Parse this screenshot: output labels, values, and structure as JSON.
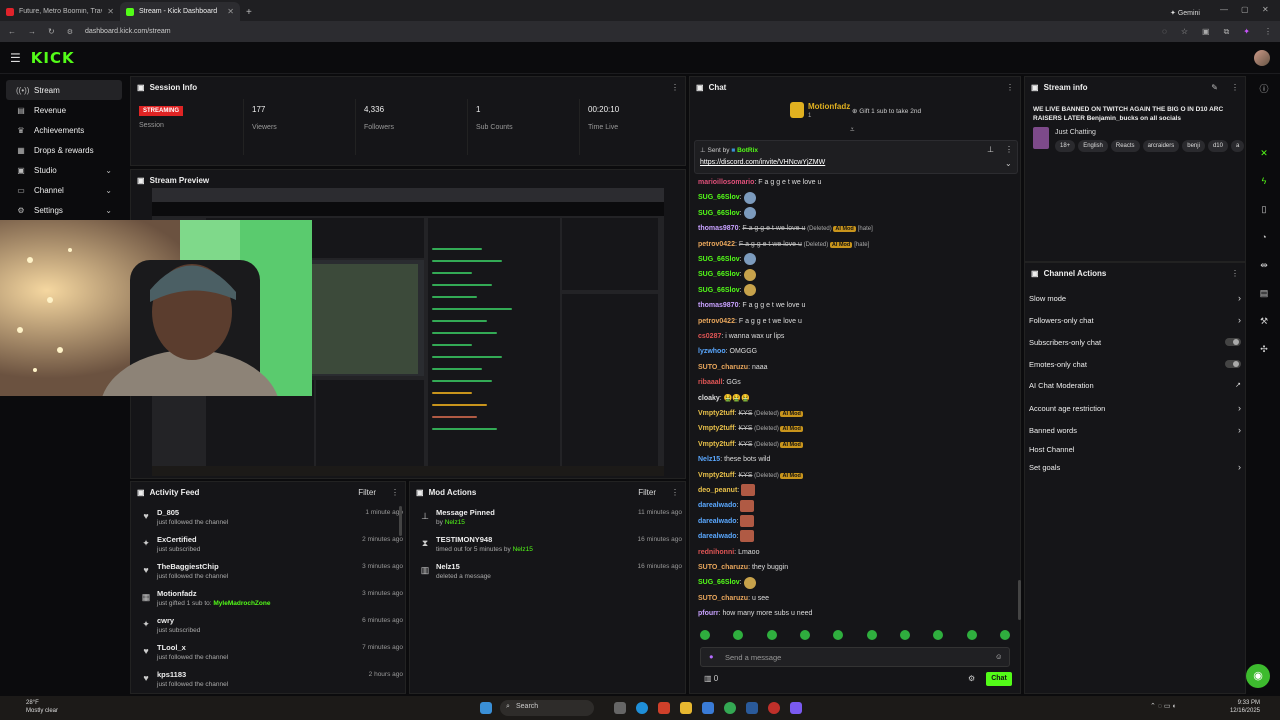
{
  "browser": {
    "tabs": [
      {
        "title": "Future, Metro Boomin, Travis S",
        "active": false,
        "color": "#e0232b"
      },
      {
        "title": "Stream - Kick Dashboard",
        "active": true,
        "color": "#53fc18"
      }
    ],
    "gemini": "Gemini",
    "url": "dashboard.kick.com/stream"
  },
  "app": {
    "logo": "KICK",
    "accent": "#53fc18"
  },
  "sidebar": {
    "items": [
      {
        "label": "Stream",
        "icon": "stream-icon",
        "active": true,
        "chevron": false
      },
      {
        "label": "Revenue",
        "icon": "revenue-icon",
        "active": false,
        "chevron": false
      },
      {
        "label": "Achievements",
        "icon": "trophy-icon",
        "active": false,
        "chevron": false
      },
      {
        "label": "Drops & rewards",
        "icon": "gift-icon",
        "active": false,
        "chevron": false
      },
      {
        "label": "Studio",
        "icon": "studio-icon",
        "active": false,
        "chevron": true
      },
      {
        "label": "Channel",
        "icon": "channel-icon",
        "active": false,
        "chevron": true
      },
      {
        "label": "Settings",
        "icon": "gear-icon",
        "active": false,
        "chevron": true
      }
    ]
  },
  "session": {
    "title": "Session Info",
    "status": "STREAMING",
    "stats": [
      {
        "value": "",
        "label": "Session"
      },
      {
        "value": "177",
        "label": "Viewers"
      },
      {
        "value": "4,336",
        "label": "Followers"
      },
      {
        "value": "1",
        "label": "Sub Counts"
      },
      {
        "value": "00:20:10",
        "label": "Time Live"
      }
    ]
  },
  "preview": {
    "title": "Stream Preview"
  },
  "activity": {
    "title": "Activity Feed",
    "filter": "Filter",
    "items": [
      {
        "name": "D_805",
        "desc": "just followed the channel",
        "time": "1 minute ago",
        "icon": "heart-icon"
      },
      {
        "name": "ExCertified",
        "desc": "just subscribed",
        "time": "2 minutes ago",
        "icon": "star-icon"
      },
      {
        "name": "TheBaggiestChip",
        "desc": "just followed the channel",
        "time": "3 minutes ago",
        "icon": "heart-icon"
      },
      {
        "name": "Motionfadz",
        "desc": "just gifted 1 sub to:",
        "target": "MyleMadrochZone",
        "time": "3 minutes ago",
        "icon": "gift-icon"
      },
      {
        "name": "cwry",
        "desc": "just subscribed",
        "time": "6 minutes ago",
        "icon": "star-icon"
      },
      {
        "name": "TLool_x",
        "desc": "just followed the channel",
        "time": "7 minutes ago",
        "icon": "heart-icon"
      },
      {
        "name": "kps1183",
        "desc": "just followed the channel",
        "time": "2 hours ago",
        "icon": "heart-icon"
      }
    ]
  },
  "mod": {
    "title": "Mod Actions",
    "filter": "Filter",
    "items": [
      {
        "name": "Message Pinned",
        "prefix": "by",
        "actor": "Nelz15",
        "time": "11 minutes ago",
        "icon": "pin-icon"
      },
      {
        "name": "TESTIMONY948",
        "prefix": "timed out for 5 minutes by",
        "actor": "Nelz15",
        "time": "16 minutes ago",
        "icon": "hourglass-icon"
      },
      {
        "name": "Nelz15",
        "prefix": "deleted a message",
        "actor": "",
        "time": "16 minutes ago",
        "icon": "trash-icon"
      }
    ]
  },
  "chat": {
    "title": "Chat",
    "gifter": "Motionfadz",
    "gifter_count": "1",
    "gift_text": "Gift 1 sub to take 2nd",
    "pinned_by_label": "Sent by",
    "pinned_by": "BotRix",
    "pinned_link": "https://discord.com/invite/VHNcwYjZMW",
    "input_placeholder": "Send a message",
    "count": "0",
    "send_label": "Chat",
    "messages": [
      {
        "user": "marioillosomario",
        "color": "#e0507a",
        "text": "F a g g e t we love u"
      },
      {
        "user": "SUG_66Slov",
        "color": "#53fc18",
        "text": "",
        "emote": "b"
      },
      {
        "user": "SUG_66Slov",
        "color": "#53fc18",
        "text": "",
        "emote": "b"
      },
      {
        "user": "thomas9870",
        "color": "#c8a2ff",
        "text": "F a g g e t we love u",
        "deleted": true,
        "aimod": "AI Mod",
        "reason": "[hate]"
      },
      {
        "user": "petrov0422",
        "color": "#e8a65c",
        "text": "F a g g e t we love u",
        "deleted": true,
        "aimod": "AI Mod",
        "reason": "[hate]"
      },
      {
        "user": "SUG_66Slov",
        "color": "#53fc18",
        "text": "",
        "emote": "b"
      },
      {
        "user": "SUG_66Slov",
        "color": "#53fc18",
        "text": "",
        "emote": "y"
      },
      {
        "user": "SUG_66Slov",
        "color": "#53fc18",
        "text": "",
        "emote": "y"
      },
      {
        "user": "thomas9870",
        "color": "#c8a2ff",
        "text": "F a g g e t we love u"
      },
      {
        "user": "petrov0422",
        "color": "#e8a65c",
        "text": "F a g g e t we love u"
      },
      {
        "user": "cs0287",
        "color": "#e05555",
        "text": "i wanna wax ur lips"
      },
      {
        "user": "lyzwhoo",
        "color": "#5aa8ff",
        "text": "OMGGG"
      },
      {
        "user": "SUTO_charuzu",
        "color": "#e8a65c",
        "text": "naaa"
      },
      {
        "user": "ribaaall",
        "color": "#e05555",
        "text": "GGs"
      },
      {
        "user": "cloaky",
        "color": "#dddddd",
        "text": "🤮🤮🤮"
      },
      {
        "user": "Vmpty2tuff",
        "color": "#e8c04a",
        "text": "KYS",
        "deleted": true,
        "aimod": "AI Mod"
      },
      {
        "user": "Vmpty2tuff",
        "color": "#e8c04a",
        "text": "KYS",
        "deleted": true,
        "aimod": "AI Mod"
      },
      {
        "user": "Vmpty2tuff",
        "color": "#e8c04a",
        "text": "KYS",
        "deleted": true,
        "aimod": "AI Mod"
      },
      {
        "user": "Nelz15",
        "color": "#5aa8ff",
        "text": "these bots wild"
      },
      {
        "user": "Vmpty2tuff",
        "color": "#e8c04a",
        "text": "KYS",
        "deleted": true,
        "aimod": "AI Mod"
      },
      {
        "user": "deo_peanut",
        "color": "#e8c04a",
        "text": "",
        "emote": "r"
      },
      {
        "user": "darealwado",
        "color": "#5aa8ff",
        "text": "",
        "emote": "r"
      },
      {
        "user": "darealwado",
        "color": "#5aa8ff",
        "text": "",
        "emote": "r"
      },
      {
        "user": "darealwado",
        "color": "#5aa8ff",
        "text": "",
        "emote": "r"
      },
      {
        "user": "rednihonni",
        "color": "#e05555",
        "text": "Lmaoo"
      },
      {
        "user": "SUTO_charuzu",
        "color": "#e8a65c",
        "text": "they buggin"
      },
      {
        "user": "SUG_66Slov",
        "color": "#53fc18",
        "text": "",
        "emote": "y"
      },
      {
        "user": "SUTO_charuzu",
        "color": "#e8a65c",
        "text": "u see"
      },
      {
        "user": "pfourr",
        "color": "#c8a2ff",
        "text": "how many more subs u need"
      }
    ]
  },
  "stream_info": {
    "title": "Stream info",
    "stream_title": "WE LIVE BANNED ON TWITCH AGAIN THE BIG O IN D10 ARC RAISERS LATER Benjamin_bucks on all socials",
    "category": "Just Chatting",
    "tags": [
      "18+",
      "English",
      "Reacts",
      "arcraiders",
      "benji",
      "d10",
      "a"
    ]
  },
  "channel_actions": {
    "title": "Channel Actions",
    "items": [
      {
        "label": "Slow mode",
        "control": "chevron"
      },
      {
        "label": "Followers-only chat",
        "control": "chevron"
      },
      {
        "label": "Subscribers-only chat",
        "control": "toggle"
      },
      {
        "label": "Emotes-only chat",
        "control": "toggle"
      },
      {
        "label": "AI Chat Moderation",
        "control": "external"
      },
      {
        "label": "Account age restriction",
        "control": "chevron"
      },
      {
        "label": "Banned words",
        "control": "chevron"
      },
      {
        "label": "Host Channel",
        "control": "none"
      },
      {
        "label": "Set goals",
        "control": "chevron"
      }
    ]
  },
  "taskbar": {
    "weather_temp": "28°F",
    "weather_desc": "Mostly clear",
    "search": "Search",
    "time": "9:33 PM",
    "date": "12/16/2025"
  }
}
